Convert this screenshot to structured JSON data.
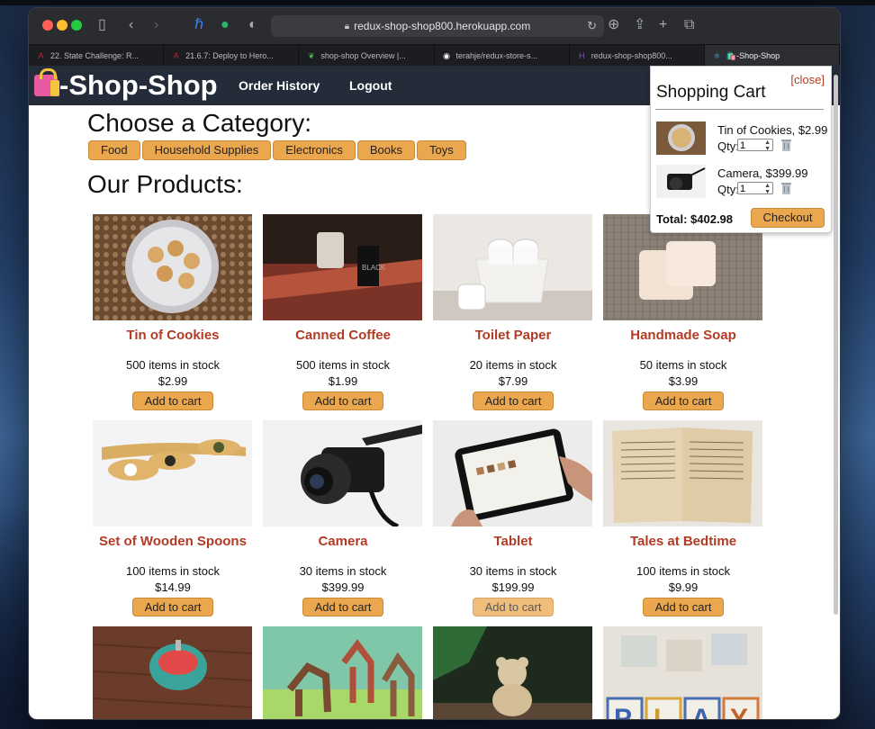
{
  "browser": {
    "url": "redux-shop-shop800.herokuapp.com",
    "tabs": [
      {
        "label": "22. State Challenge: R...",
        "icon": "arizona-icon",
        "color": "#b8233d"
      },
      {
        "label": "21.6.7: Deploy to Hero...",
        "icon": "arizona-icon",
        "color": "#b8233d"
      },
      {
        "label": "shop-shop Overview |...",
        "icon": "leaf-icon",
        "color": "#4bb04f"
      },
      {
        "label": "terahje/redux-store-s...",
        "icon": "github-icon",
        "color": "#ffffff"
      },
      {
        "label": "redux-shop-shop800...",
        "icon": "heroku-icon",
        "color": "#7b52b3"
      },
      {
        "label": "🛍️-Shop-Shop",
        "icon": "react-icon",
        "color": "#3ac4e0",
        "active": true
      }
    ]
  },
  "header": {
    "brand": "-Shop-Shop",
    "nav": [
      "Order History",
      "Logout"
    ]
  },
  "categories": {
    "heading": "Choose a Category:",
    "items": [
      "Food",
      "Household Supplies",
      "Electronics",
      "Books",
      "Toys"
    ]
  },
  "products": {
    "heading": "Our Products:",
    "add_label": "Add to cart",
    "items": [
      {
        "name": "Tin of Cookies",
        "stock": "500 items in stock",
        "price": "$2.99",
        "image": "cookies"
      },
      {
        "name": "Canned Coffee",
        "stock": "500 items in stock",
        "price": "$1.99",
        "image": "coffee"
      },
      {
        "name": "Toilet Paper",
        "stock": "20 items in stock",
        "price": "$7.99",
        "image": "toilet-paper"
      },
      {
        "name": "Handmade Soap",
        "stock": "50 items in stock",
        "price": "$3.99",
        "image": "soap"
      },
      {
        "name": "Set of Wooden Spoons",
        "stock": "100 items in stock",
        "price": "$14.99",
        "image": "spoons"
      },
      {
        "name": "Camera",
        "stock": "30 items in stock",
        "price": "$399.99",
        "image": "camera"
      },
      {
        "name": "Tablet",
        "stock": "30 items in stock",
        "price": "$199.99",
        "image": "tablet"
      },
      {
        "name": "Tales at Bedtime",
        "stock": "100 items in stock",
        "price": "$9.99",
        "image": "book"
      },
      {
        "image": "spinning-top"
      },
      {
        "image": "horses"
      },
      {
        "image": "teddy-bear"
      },
      {
        "image": "alphabet-blocks"
      }
    ]
  },
  "cart": {
    "close_label": "[close]",
    "title": "Shopping Cart",
    "qty_label": "Qty:",
    "items": [
      {
        "name": "Tin of Cookies, $2.99",
        "qty": "1",
        "image": "cookies"
      },
      {
        "name": "Camera, $399.99",
        "qty": "1",
        "image": "camera"
      }
    ],
    "total": "Total: $402.98",
    "checkout_label": "Checkout"
  },
  "colors": {
    "accent": "#eba74e",
    "product_name": "#b23b24",
    "header_bg": "#242c3a"
  }
}
